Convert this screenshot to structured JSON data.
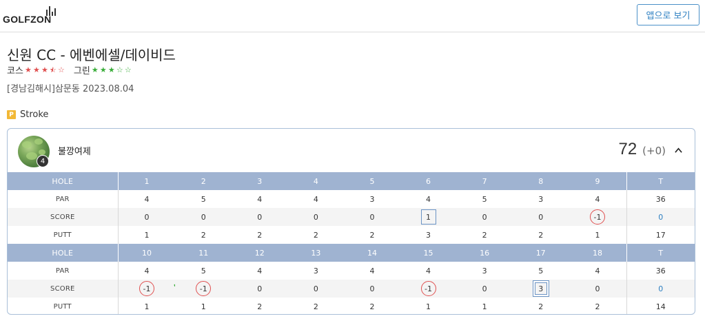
{
  "header": {
    "logo_text": "GOLFZON",
    "app_button": "앱으로 보기"
  },
  "course": {
    "title": "신원 CC - 에벤에셀/데이비드",
    "course_label": "코스",
    "course_rating": 3.5,
    "green_label": "그린",
    "green_rating": 3,
    "location": "[경남김해시]삼문동 2023.08.04"
  },
  "mode": {
    "badge": "P",
    "label": "Stroke"
  },
  "player": {
    "name": "불깡여제",
    "level": "4",
    "total": "72",
    "diff": "(+0)"
  },
  "scorecard": {
    "labels": {
      "hole": "HOLE",
      "par": "PAR",
      "score": "SCORE",
      "putt": "PUTT",
      "total": "T"
    },
    "front": {
      "holes": [
        "1",
        "2",
        "3",
        "4",
        "5",
        "6",
        "7",
        "8",
        "9"
      ],
      "par": [
        "4",
        "5",
        "4",
        "4",
        "3",
        "4",
        "5",
        "3",
        "4"
      ],
      "score": [
        "0",
        "0",
        "0",
        "0",
        "0",
        "1",
        "0",
        "0",
        "-1"
      ],
      "putt": [
        "1",
        "2",
        "2",
        "2",
        "2",
        "3",
        "2",
        "2",
        "1"
      ],
      "par_total": "36",
      "score_total": "0",
      "putt_total": "17"
    },
    "back": {
      "holes": [
        "10",
        "11",
        "12",
        "13",
        "14",
        "15",
        "16",
        "17",
        "18"
      ],
      "par": [
        "4",
        "5",
        "4",
        "3",
        "4",
        "4",
        "3",
        "5",
        "4"
      ],
      "score": [
        "-1",
        "-1",
        "0",
        "0",
        "0",
        "-1",
        "0",
        "3",
        "0"
      ],
      "putt": [
        "1",
        "1",
        "2",
        "2",
        "2",
        "1",
        "1",
        "2",
        "2"
      ],
      "par_total": "36",
      "score_total": "0",
      "putt_total": "14"
    }
  },
  "colors": {
    "accent": "#2d7fc1",
    "header_row": "#9fb3d1",
    "birdie": "#e05050",
    "bogey": "#6a93c4",
    "star_course": "#e05050",
    "star_green": "#3aad3a"
  }
}
